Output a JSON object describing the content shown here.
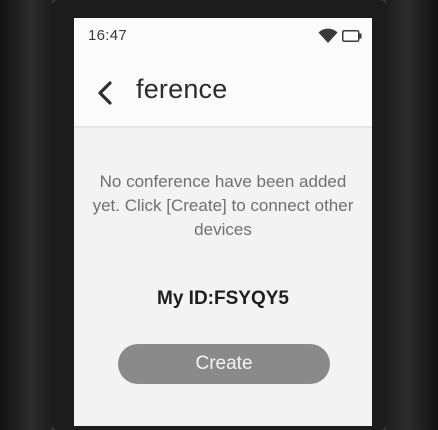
{
  "status_bar": {
    "time": "16:47",
    "wifi_icon": "wifi-icon",
    "battery_icon": "battery-icon"
  },
  "header": {
    "back_icon": "chevron-left-icon",
    "title": "ference"
  },
  "empty_state": {
    "message": "No conference have been added yet. Click [Create] to connect other devices",
    "my_id": "My ID:FSYQY5"
  },
  "actions": {
    "create_label": "Create"
  },
  "colors": {
    "screen_bg": "#fbfbfb",
    "body_bg": "#f3f3f3",
    "button_bg": "#8a8a8a",
    "text_primary": "#1e1e1e",
    "text_secondary": "#707070"
  }
}
